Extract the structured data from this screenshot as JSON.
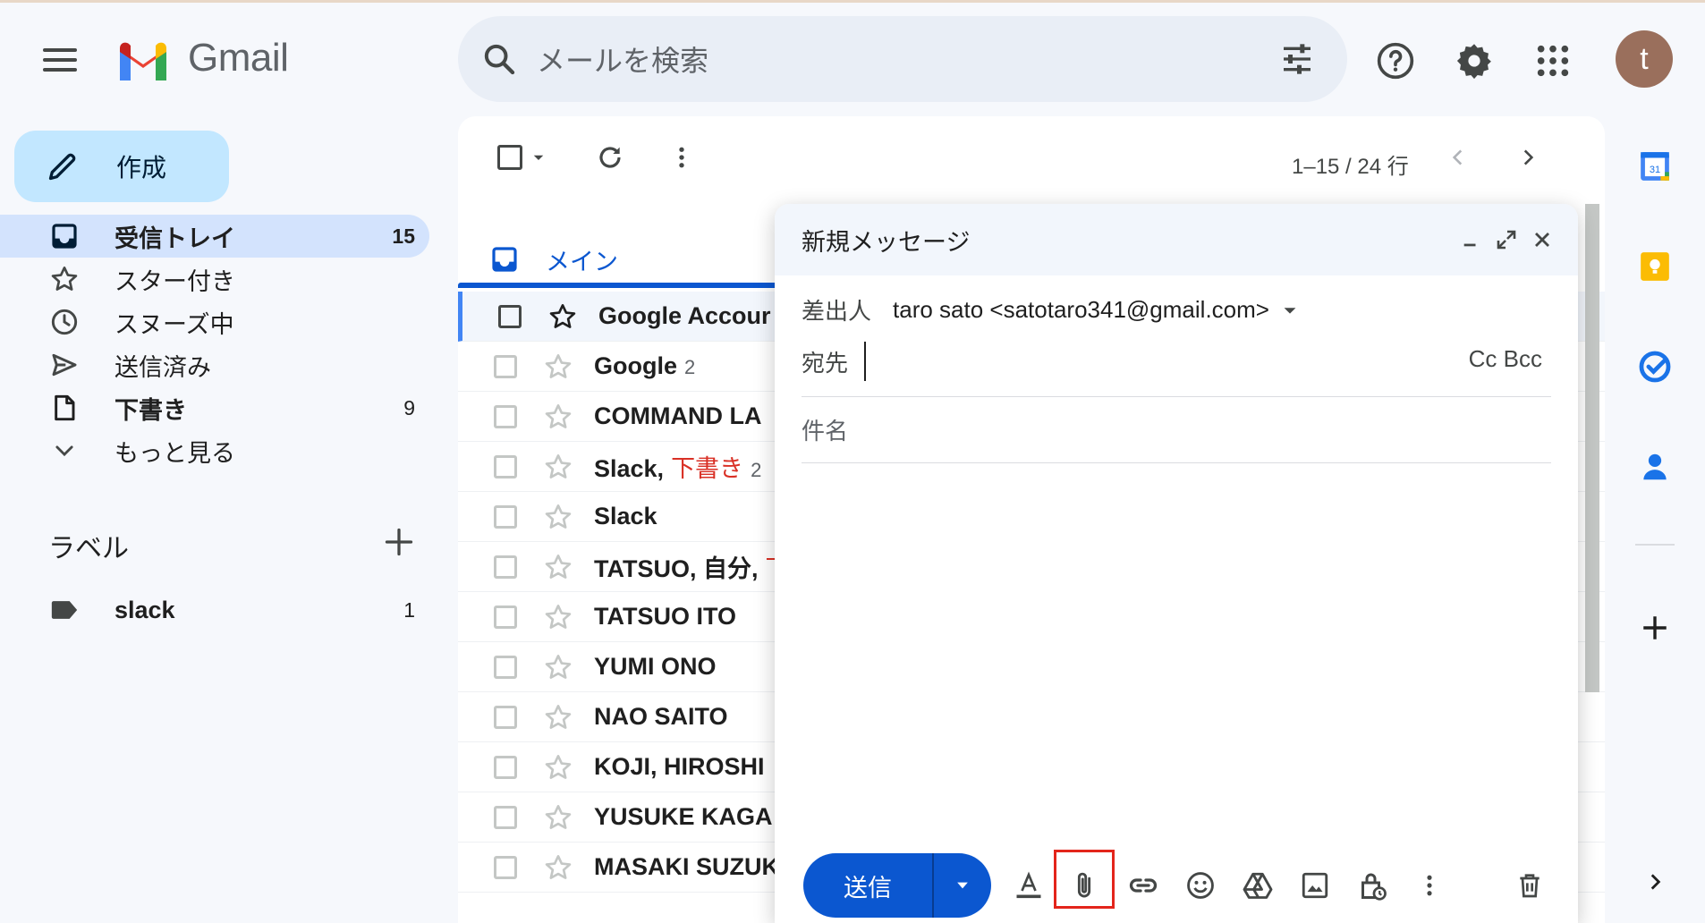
{
  "app": {
    "name": "Gmail"
  },
  "search": {
    "placeholder": "メールを検索"
  },
  "user": {
    "avatar_letter": "t"
  },
  "compose_button": {
    "label": "作成"
  },
  "nav": {
    "items": [
      {
        "label": "受信トレイ",
        "count": "15"
      },
      {
        "label": "スター付き",
        "count": ""
      },
      {
        "label": "スヌーズ中",
        "count": ""
      },
      {
        "label": "送信済み",
        "count": ""
      },
      {
        "label": "下書き",
        "count": "9"
      },
      {
        "label": "もっと見る",
        "count": ""
      }
    ]
  },
  "labels": {
    "title": "ラベル",
    "items": [
      {
        "label": "slack",
        "count": "1"
      }
    ]
  },
  "mail_list": {
    "pager": "1–15 / 24 行",
    "tab": "メイン",
    "rows": [
      {
        "sender": "Google Accour"
      },
      {
        "sender": "Google",
        "count": "2"
      },
      {
        "sender": "COMMAND LA"
      },
      {
        "sender": "Slack,",
        "draft": "下書き",
        "count": "2"
      },
      {
        "sender": "Slack"
      },
      {
        "sender": "TATSUO, 自分,",
        "draft": "下"
      },
      {
        "sender": "TATSUO ITO"
      },
      {
        "sender": "YUMI ONO"
      },
      {
        "sender": "NAO SAITO"
      },
      {
        "sender": "KOJI, HIROSHI"
      },
      {
        "sender": "YUSUKE KAGA"
      },
      {
        "sender": "MASAKI SUZUK"
      }
    ]
  },
  "compose_window": {
    "title": "新規メッセージ",
    "from_label": "差出人",
    "from_value": "taro sato <satotaro341@gmail.com>",
    "to_label": "宛先",
    "to_value": "",
    "cc_bcc": "Cc Bcc",
    "subject_placeholder": "件名",
    "send_label": "送信"
  },
  "colors": {
    "accent": "#0b57d0",
    "compose_bg": "#c2e7ff",
    "active_nav": "#d3e3fd",
    "highlight_box": "#e3251b"
  }
}
